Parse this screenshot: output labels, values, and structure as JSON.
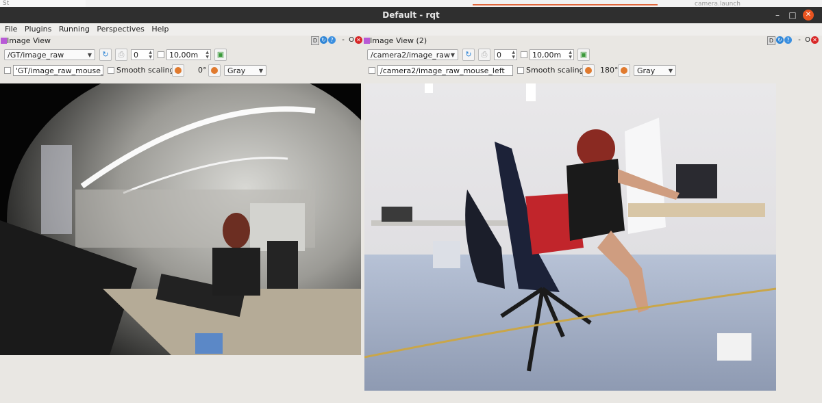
{
  "window": {
    "title": "Default - rqt",
    "background_left": "St",
    "background_right": "camera.launch"
  },
  "menu": [
    "File",
    "Plugins",
    "Running",
    "Perspectives",
    "Help"
  ],
  "panes": [
    {
      "title": "Image View",
      "topic": "/GT/image_raw",
      "spin_value": "0",
      "max_range": "10,00m",
      "mouse_topic": "'GT/image_raw_mouse_left",
      "smooth_label": "Smooth scaling",
      "rotation": "0°",
      "color_mode": "Gray",
      "dock_letter": "D",
      "dock_dash": "-",
      "dock_o": "O"
    },
    {
      "title": "Image View (2)",
      "topic": "/camera2/image_raw",
      "spin_value": "0",
      "max_range": "10,00m",
      "mouse_topic": "/camera2/image_raw_mouse_left",
      "smooth_label": "Smooth scaling",
      "rotation": "180°",
      "color_mode": "Gray",
      "dock_letter": "D",
      "dock_dash": "-",
      "dock_o": "O"
    }
  ],
  "colors": {
    "titlebar": "#2f2f2f",
    "close": "#e95420",
    "accent_orange": "#e07a2e"
  }
}
